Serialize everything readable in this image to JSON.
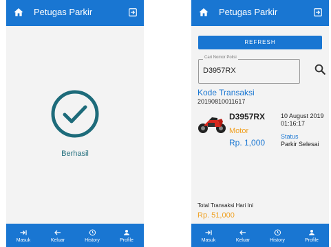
{
  "colors": {
    "primary": "#1976d2",
    "accent": "#f0a020",
    "success": "#1d6b7a"
  },
  "left": {
    "appbar": {
      "title": "Petugas Parkir",
      "home_icon": "home-icon",
      "exit_icon": "exit-icon"
    },
    "success_label": "Berhasil"
  },
  "right": {
    "appbar": {
      "title": "Petugas Parkir",
      "home_icon": "home-icon",
      "exit_icon": "exit-icon"
    },
    "refresh_label": "REFRESH",
    "search": {
      "label": "Cari Nomor Polisi",
      "value": "D3957RX"
    },
    "transaction": {
      "kode_label": "Kode Transaksi",
      "kode_value": "20190810011617",
      "plate": "D3957RX",
      "vehicle_type": "Motor",
      "price": "Rp. 1,000",
      "date": "10 August 2019",
      "time": "01:16:17",
      "status_label": "Status",
      "status_value": "Parkir Selesai"
    },
    "total": {
      "label": "Total Transaksi Hari Ini",
      "value": "Rp. 51,000"
    }
  },
  "nav": [
    {
      "label": "Masuk",
      "icon": "login-arrow-icon"
    },
    {
      "label": "Keluar",
      "icon": "back-arrow-icon"
    },
    {
      "label": "History",
      "icon": "history-icon"
    },
    {
      "label": "Profile",
      "icon": "person-icon"
    }
  ]
}
